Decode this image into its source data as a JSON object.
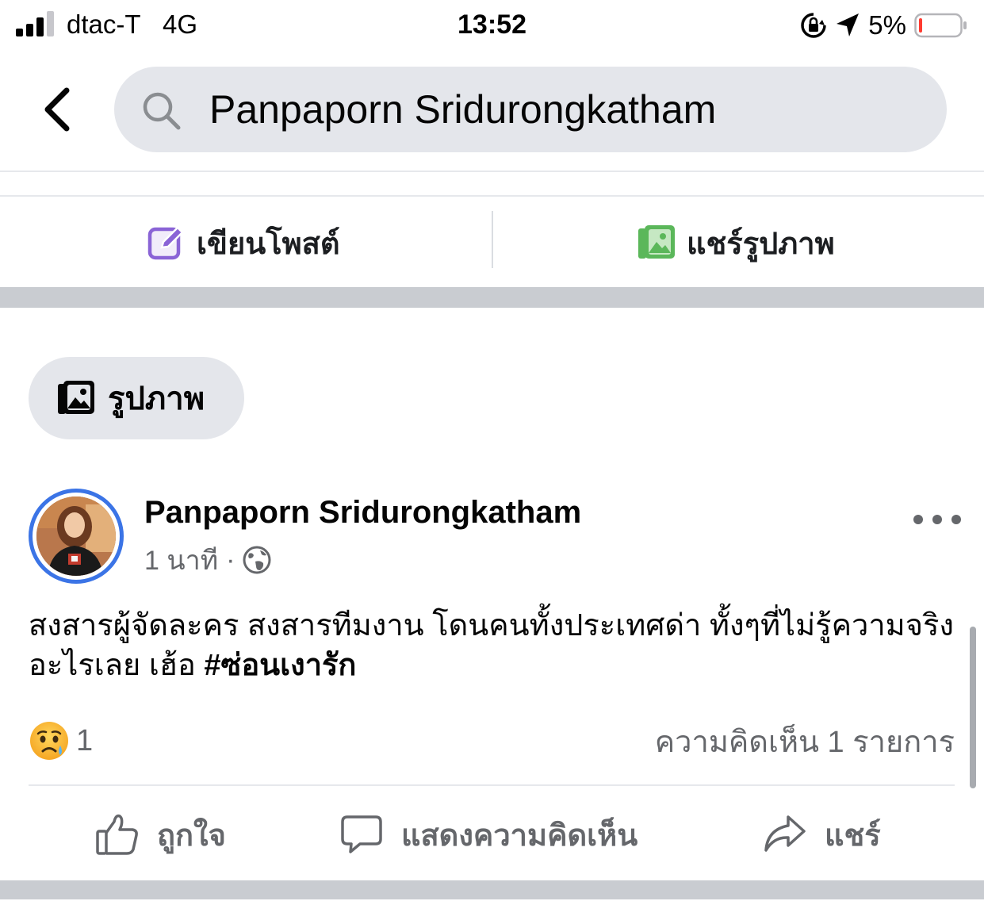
{
  "status_bar": {
    "carrier": "dtac-T",
    "network": "4G",
    "time": "13:52",
    "battery_percent": "5%",
    "signal_bars": 3,
    "battery_level": 0.05,
    "battery_color": "#ff3b30"
  },
  "header": {
    "back_icon": "chevron-left-icon",
    "search_icon": "search-icon",
    "search_value": "Panpaporn Sridurongkatham"
  },
  "composer": {
    "write_post_label": "เขียนโพสต์",
    "write_post_icon": "edit-icon",
    "share_photo_label": "แชร์รูปภาพ",
    "share_photo_icon": "photo-icon",
    "write_icon_color": "#8a64d6",
    "photo_icon_color": "#5bb75a"
  },
  "filter_chip": {
    "label": "รูปภาพ",
    "icon": "photos-icon"
  },
  "post": {
    "author": "Panpaporn Sridurongkatham",
    "time": "1 นาที",
    "separator": "·",
    "privacy_icon": "globe-icon",
    "more_icon": "more-options-icon",
    "text": "สงสารผู้จัดละคร สงสารทีมงาน โดนคนทั้งประเทศด่า ทั้งๆที่ไม่รู้ความจริงอะไรเลย เฮ้อ ",
    "hashtag": "#ซ่อนเงารัก",
    "reaction_icon": "sad-face-icon",
    "reaction_count": "1",
    "comment_count_label": "ความคิดเห็น 1 รายการ",
    "story_ring_color": "#3b74e6"
  },
  "actions": {
    "like_label": "ถูกใจ",
    "comment_label": "แสดงความคิดเห็น",
    "share_label": "แชร์"
  }
}
